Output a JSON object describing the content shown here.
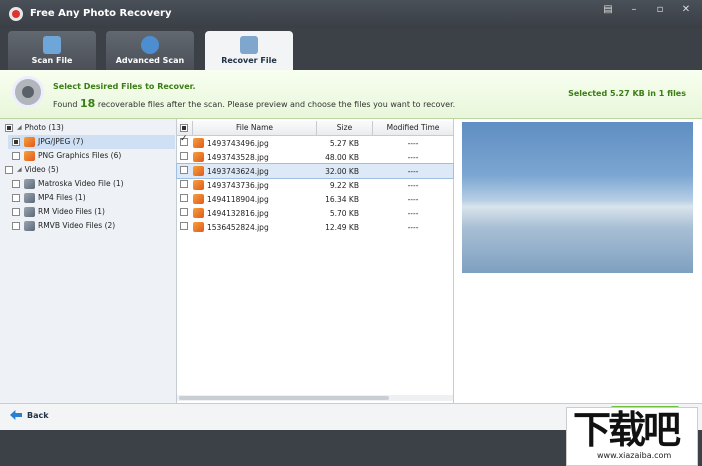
{
  "window": {
    "title": "Free Any Photo Recovery",
    "controls": [
      "▤",
      "–",
      "▫",
      "✕"
    ]
  },
  "tabs": [
    {
      "label": "Scan File",
      "color": "#6ea6d8"
    },
    {
      "label": "Advanced Scan",
      "color": "#4d8ed1"
    },
    {
      "label": "Recover File",
      "color": "#7fa6cc"
    }
  ],
  "banner": {
    "heading": "Select Desired Files to Recover.",
    "sub_before": "Found ",
    "count": "18",
    "sub_after": " recoverable files after the scan. Please preview and choose the files you want to recover.",
    "selected": "Selected 5.27 KB in 1 files"
  },
  "tree": {
    "photo": "Photo (13)",
    "jpg": "JPG/JPEG (7)",
    "png": "PNG Graphics Files (6)",
    "video": "Video (5)",
    "mkv": "Matroska Video File (1)",
    "mp4": "MP4 Files (1)",
    "rm": "RM Video Files (1)",
    "rmvb": "RMVB Video Files (2)"
  },
  "filelist": {
    "columns": {
      "name": "File Name",
      "size": "Size",
      "time": "Modified Time"
    },
    "rows": [
      {
        "name": "1493743496.jpg",
        "size": "5.27 KB",
        "time": "----"
      },
      {
        "name": "1493743528.jpg",
        "size": "48.00 KB",
        "time": "----"
      },
      {
        "name": "1493743624.jpg",
        "size": "32.00 KB",
        "time": "----"
      },
      {
        "name": "1493743736.jpg",
        "size": "9.22 KB",
        "time": "----"
      },
      {
        "name": "1494118904.jpg",
        "size": "16.34 KB",
        "time": "----"
      },
      {
        "name": "1494132816.jpg",
        "size": "5.70 KB",
        "time": "----"
      },
      {
        "name": "1536452824.jpg",
        "size": "12.49 KB",
        "time": "----"
      }
    ]
  },
  "footer": {
    "back": "Back"
  },
  "watermark": {
    "text": "下载吧",
    "url": "www.xiazaiba.com"
  }
}
